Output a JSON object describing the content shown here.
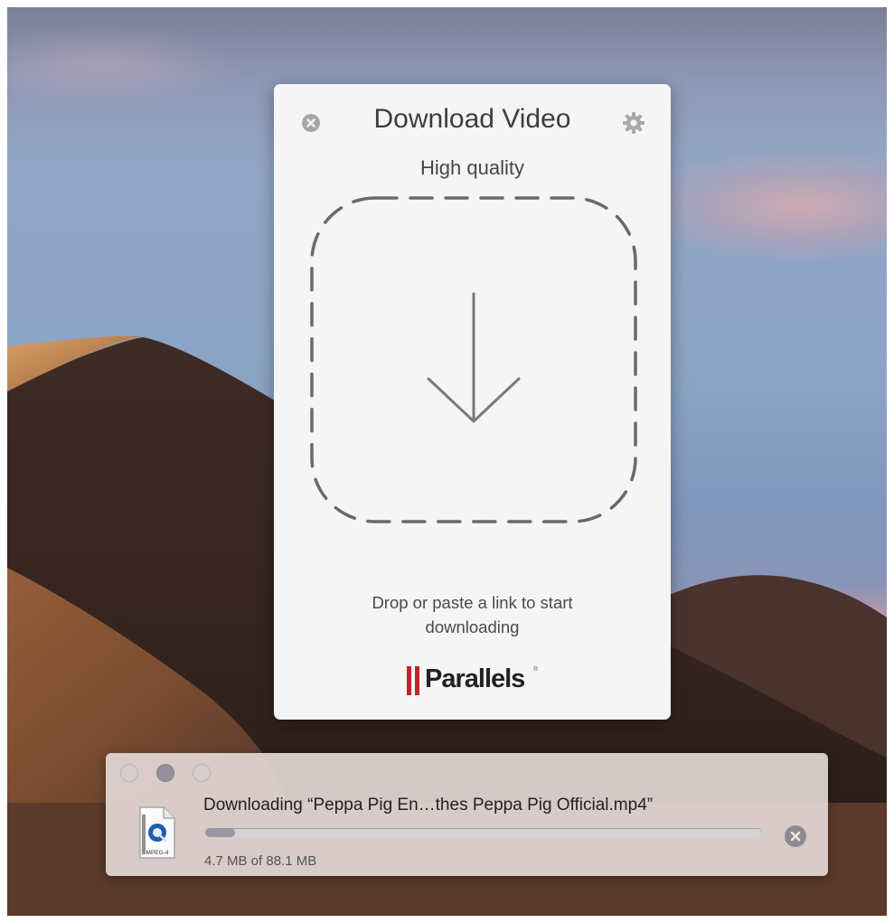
{
  "panel": {
    "title": "Download Video",
    "subtitle": "High quality",
    "hint": "Drop or paste a link to start downloading",
    "brand": "Parallels",
    "brand_mark": "®",
    "icons": {
      "close": "close-circle-icon",
      "settings": "gear-icon",
      "download": "download-arrow-icon"
    }
  },
  "download_window": {
    "title": "Downloading “Peppa Pig En…thes  Peppa Pig Official.mp4”",
    "size": "4.7 MB of 88.1 MB",
    "file_icon_label": "MPEG-4",
    "progress_fraction": 0.0533,
    "icons": {
      "cancel": "cancel-circle-icon",
      "file": "video-file-icon"
    }
  },
  "colors": {
    "brand_red": "#c8202f",
    "panel_bg": "#f5f5f5",
    "dashed_border": "#6a6a6a"
  }
}
